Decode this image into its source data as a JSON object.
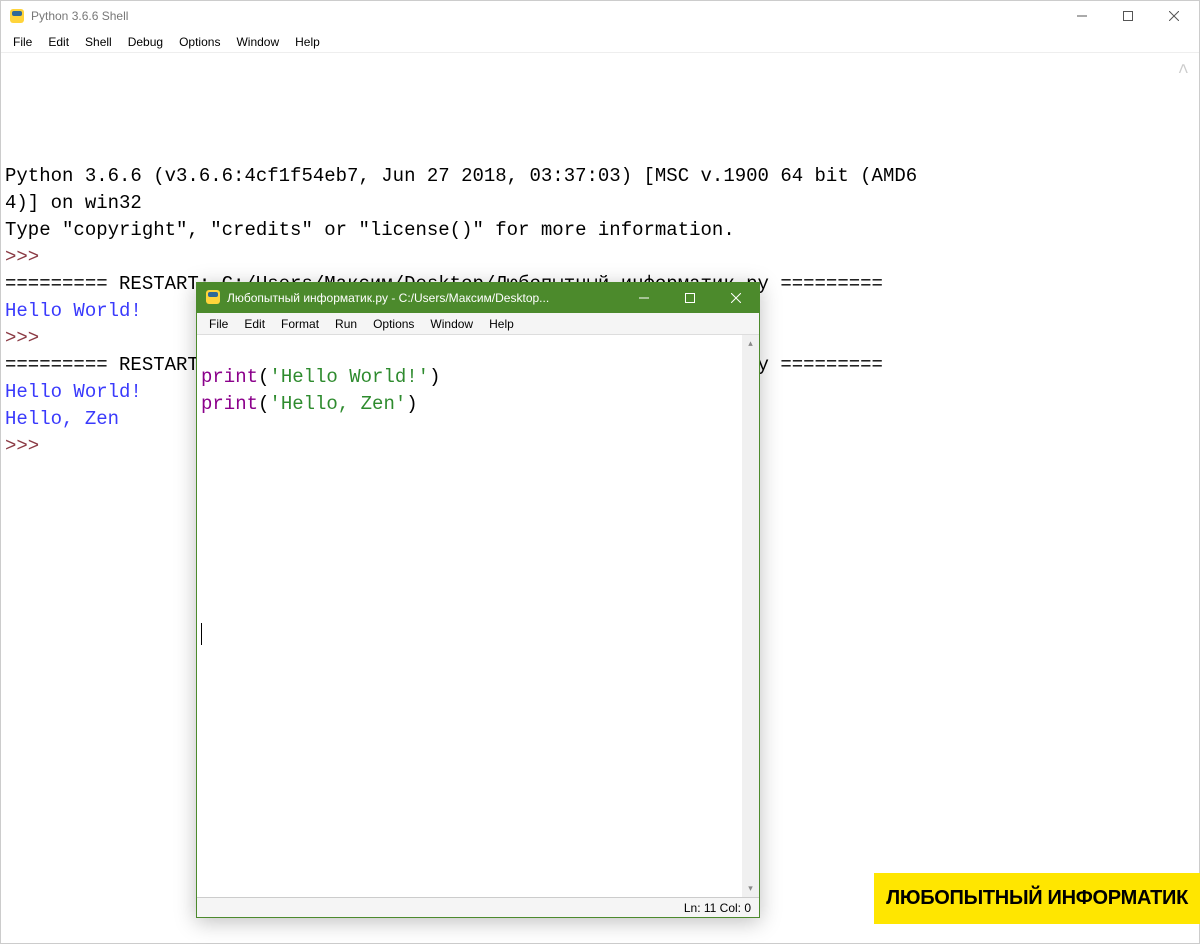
{
  "shell": {
    "title": "Python 3.6.6 Shell",
    "menu": [
      "File",
      "Edit",
      "Shell",
      "Debug",
      "Options",
      "Window",
      "Help"
    ],
    "banner_line1": "Python 3.6.6 (v3.6.6:4cf1f54eb7, Jun 27 2018, 03:37:03) [MSC v.1900 64 bit (AMD6",
    "banner_line2": "4)] on win32",
    "banner_line3": "Type \"copyright\", \"credits\" or \"license()\" for more information.",
    "prompt": ">>> ",
    "restart_line": "========= RESTART: C:/Users/Максим/Desktop/Любопытный информатик.py =========",
    "output1": "Hello World!",
    "output2": "Hello, Zen",
    "caret": "^"
  },
  "editor": {
    "title": "Любопытный информатик.py - C:/Users/Максим/Desktop...",
    "menu": [
      "File",
      "Edit",
      "Format",
      "Run",
      "Options",
      "Window",
      "Help"
    ],
    "lines": [
      {
        "kw": "print",
        "paren_open": "(",
        "str": "'Hello World!'",
        "paren_close": ")"
      },
      {
        "kw": "print",
        "paren_open": "(",
        "str": "'Hello, Zen'",
        "paren_close": ")"
      }
    ],
    "status": "Ln: 11  Col: 0"
  },
  "watermark": "ЛЮБОПЫТНЫЙ ИНФОРМАТИК"
}
